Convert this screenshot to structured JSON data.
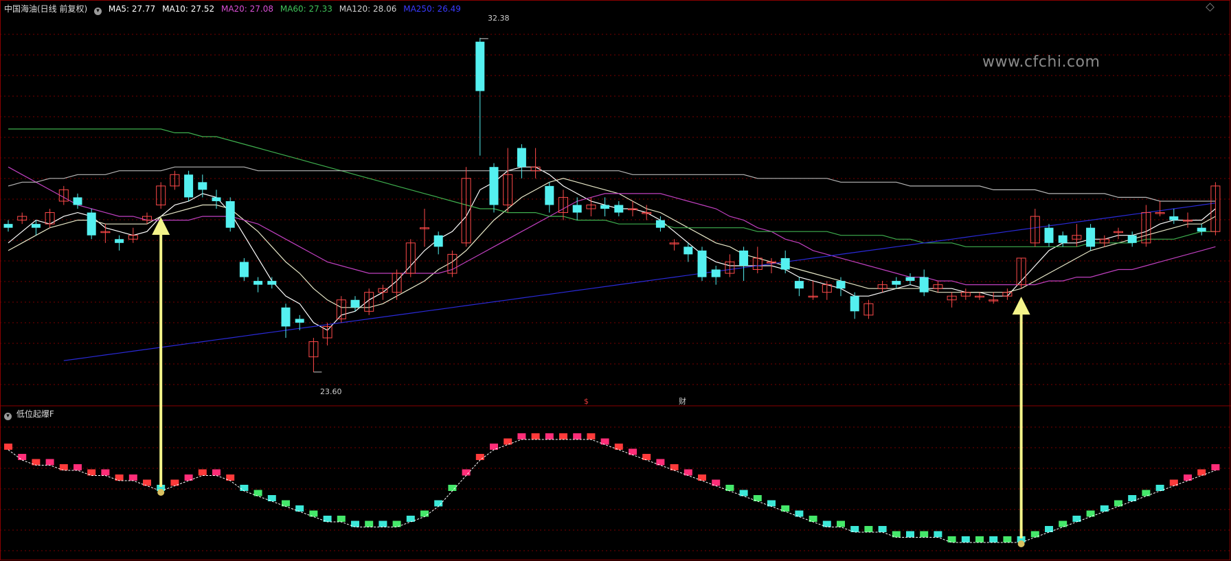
{
  "header": {
    "security": "中国海油(日线 前复权)",
    "ma_items": [
      {
        "label": "MA5: 27.77",
        "color": "#ffffff"
      },
      {
        "label": "MA10: 27.52",
        "color": "#ffffff"
      },
      {
        "label": "MA20: 27.08",
        "color": "#d94fd4"
      },
      {
        "label": "MA60: 27.33",
        "color": "#3fc35a"
      },
      {
        "label": "MA120: 28.06",
        "color": "#cfcfcf"
      },
      {
        "label": "MA250: 26.49",
        "color": "#3a3aff"
      }
    ]
  },
  "watermark": "www.cfchi.com",
  "price_high_label": "32.38",
  "price_low_label": "23.60",
  "event_marks": [
    "$",
    "财"
  ],
  "indicator_title": "低位起爆F",
  "colors": {
    "up": "#ff4a4a",
    "down": "#54f0f0",
    "grid": "#7a0000",
    "ma5": "#ffffff",
    "ma10": "#e8e8c8",
    "ma20": "#c040c0",
    "ma60": "#3fb04f",
    "ma120": "#b8b8b8",
    "ma250": "#2a2ad8",
    "arrow": "#f4f48a"
  },
  "chart_data": {
    "type": "candlestick",
    "price_range": [
      23.0,
      33.0
    ],
    "candles": [
      [
        27.5,
        27.4,
        27.6,
        27.3
      ],
      [
        27.6,
        27.7,
        27.8,
        27.5
      ],
      [
        27.5,
        27.4,
        27.6,
        27.2
      ],
      [
        27.5,
        27.8,
        27.9,
        27.4
      ],
      [
        28.1,
        28.4,
        28.5,
        28.0
      ],
      [
        28.2,
        28.0,
        28.3,
        27.9
      ],
      [
        27.8,
        27.2,
        27.9,
        27.1
      ],
      [
        27.3,
        27.3,
        27.5,
        27.0
      ],
      [
        27.1,
        27.0,
        27.2,
        26.8
      ],
      [
        27.1,
        27.2,
        27.4,
        27.0
      ],
      [
        27.6,
        27.7,
        27.8,
        27.5
      ],
      [
        28.0,
        28.5,
        28.6,
        27.9
      ],
      [
        28.5,
        28.8,
        28.9,
        28.4
      ],
      [
        28.8,
        28.2,
        28.9,
        28.1
      ],
      [
        28.6,
        28.4,
        28.8,
        28.2
      ],
      [
        28.2,
        28.1,
        28.4,
        27.9
      ],
      [
        28.1,
        27.4,
        28.2,
        27.3
      ],
      [
        26.5,
        26.1,
        26.6,
        26.0
      ],
      [
        26.0,
        25.9,
        26.1,
        25.7
      ],
      [
        26.0,
        25.9,
        26.1,
        25.8
      ],
      [
        25.3,
        24.8,
        25.4,
        24.5
      ],
      [
        25.0,
        24.9,
        25.1,
        24.7
      ],
      [
        24.0,
        24.4,
        24.5,
        23.6
      ],
      [
        24.5,
        24.8,
        24.9,
        24.3
      ],
      [
        25.0,
        25.5,
        25.6,
        24.9
      ],
      [
        25.5,
        25.3,
        25.6,
        25.2
      ],
      [
        25.2,
        25.7,
        25.8,
        25.1
      ],
      [
        25.7,
        25.8,
        25.9,
        25.5
      ],
      [
        25.7,
        26.2,
        26.3,
        25.5
      ],
      [
        26.2,
        27.0,
        27.1,
        26.1
      ],
      [
        27.4,
        27.4,
        27.9,
        26.9
      ],
      [
        27.2,
        26.9,
        27.3,
        26.7
      ],
      [
        26.2,
        26.7,
        26.8,
        26.1
      ],
      [
        27.0,
        28.7,
        29.0,
        26.9
      ],
      [
        32.3,
        31.0,
        32.4,
        29.3
      ],
      [
        29.0,
        28.0,
        29.1,
        27.8
      ],
      [
        28.0,
        28.8,
        29.5,
        27.8
      ],
      [
        29.5,
        29.0,
        29.6,
        28.7
      ],
      [
        28.9,
        29.0,
        29.5,
        28.7
      ],
      [
        28.5,
        28.0,
        28.6,
        27.8
      ],
      [
        27.8,
        28.2,
        28.4,
        27.6
      ],
      [
        28.0,
        27.8,
        28.2,
        27.6
      ],
      [
        27.9,
        28.0,
        28.2,
        27.7
      ],
      [
        28.0,
        27.9,
        28.2,
        27.7
      ],
      [
        28.0,
        27.8,
        28.1,
        27.7
      ],
      [
        27.9,
        27.9,
        28.1,
        27.7
      ],
      [
        27.8,
        27.8,
        28.0,
        27.6
      ],
      [
        27.6,
        27.4,
        27.7,
        27.3
      ],
      [
        27.0,
        27.0,
        27.1,
        26.8
      ],
      [
        26.9,
        26.7,
        27.0,
        26.5
      ],
      [
        26.8,
        26.1,
        26.9,
        26.0
      ],
      [
        26.3,
        26.1,
        26.4,
        25.9
      ],
      [
        26.2,
        26.5,
        26.7,
        26.1
      ],
      [
        26.8,
        26.4,
        26.9,
        26.0
      ],
      [
        26.3,
        26.6,
        26.9,
        26.2
      ],
      [
        26.5,
        26.5,
        26.6,
        26.2
      ],
      [
        26.6,
        26.3,
        26.8,
        26.2
      ],
      [
        26.0,
        25.8,
        26.1,
        25.6
      ],
      [
        25.6,
        25.6,
        26.0,
        25.5
      ],
      [
        25.7,
        25.9,
        26.0,
        25.5
      ],
      [
        26.0,
        25.8,
        26.1,
        25.6
      ],
      [
        25.6,
        25.2,
        25.7,
        25.0
      ],
      [
        25.1,
        25.4,
        25.5,
        25.0
      ],
      [
        25.8,
        25.9,
        26.0,
        25.7
      ],
      [
        26.0,
        25.9,
        26.1,
        25.8
      ],
      [
        26.1,
        26.0,
        26.2,
        25.9
      ],
      [
        26.1,
        25.7,
        26.3,
        25.6
      ],
      [
        25.8,
        25.9,
        26.0,
        25.7
      ],
      [
        25.5,
        25.6,
        25.7,
        25.3
      ],
      [
        25.6,
        25.7,
        25.8,
        25.5
      ],
      [
        25.6,
        25.6,
        25.7,
        25.5
      ],
      [
        25.5,
        25.5,
        25.7,
        25.4
      ],
      [
        25.6,
        25.7,
        25.8,
        25.5
      ],
      [
        25.9,
        26.6,
        26.6,
        25.8
      ],
      [
        27.0,
        27.7,
        27.9,
        26.9
      ],
      [
        27.4,
        27.0,
        27.5,
        26.9
      ],
      [
        27.2,
        27.0,
        27.3,
        26.9
      ],
      [
        27.1,
        27.2,
        27.5,
        26.9
      ],
      [
        27.4,
        26.9,
        27.5,
        26.8
      ],
      [
        27.0,
        27.1,
        27.2,
        26.9
      ],
      [
        27.3,
        27.3,
        27.4,
        27.1
      ],
      [
        27.2,
        27.0,
        27.3,
        26.9
      ],
      [
        27.0,
        27.8,
        28.0,
        26.9
      ],
      [
        27.8,
        27.8,
        28.1,
        27.7
      ],
      [
        27.7,
        27.6,
        27.9,
        27.5
      ],
      [
        27.6,
        27.6,
        27.8,
        27.4
      ],
      [
        27.4,
        27.3,
        27.5,
        27.2
      ],
      [
        27.3,
        28.5,
        28.6,
        27.2
      ]
    ],
    "ma_lines": [
      {
        "name": "MA5",
        "values": [
          27.0,
          27.3,
          27.6,
          27.5,
          27.7,
          27.8,
          27.7,
          27.4,
          27.3,
          27.2,
          27.3,
          27.7,
          28.0,
          28.1,
          28.3,
          28.2,
          27.8,
          27.2,
          26.6,
          26.0,
          25.6,
          25.4,
          24.9,
          24.7,
          25.1,
          25.2,
          25.5,
          25.7,
          26.0,
          26.4,
          26.8,
          27.1,
          27.3,
          27.7,
          28.4,
          28.6,
          28.9,
          29.0,
          29.0,
          28.8,
          28.5,
          28.3,
          28.1,
          28.0,
          27.9,
          27.9,
          27.8,
          27.6,
          27.3,
          27.0,
          26.7,
          26.5,
          26.4,
          26.4,
          26.4,
          26.4,
          26.3,
          26.1,
          26.0,
          25.9,
          25.8,
          25.6,
          25.6,
          25.7,
          25.8,
          25.9,
          25.8,
          25.8,
          25.8,
          25.7,
          25.7,
          25.6,
          25.6,
          26.0,
          26.4,
          26.8,
          27.0,
          27.0,
          27.1,
          27.1,
          27.2,
          27.2,
          27.3,
          27.5,
          27.6,
          27.6,
          27.6,
          27.9
        ]
      },
      {
        "name": "MA10",
        "values": [
          26.8,
          27.0,
          27.2,
          27.4,
          27.5,
          27.6,
          27.6,
          27.5,
          27.5,
          27.5,
          27.5,
          27.7,
          27.8,
          27.9,
          28.0,
          28.0,
          27.9,
          27.6,
          27.3,
          26.9,
          26.5,
          26.2,
          25.8,
          25.5,
          25.3,
          25.3,
          25.3,
          25.4,
          25.6,
          25.8,
          26.0,
          26.3,
          26.5,
          26.8,
          27.2,
          27.6,
          27.9,
          28.2,
          28.4,
          28.6,
          28.7,
          28.6,
          28.5,
          28.4,
          28.3,
          28.1,
          27.9,
          27.8,
          27.6,
          27.4,
          27.2,
          27.0,
          26.9,
          26.7,
          26.6,
          26.5,
          26.4,
          26.3,
          26.2,
          26.1,
          26.0,
          25.9,
          25.8,
          25.8,
          25.8,
          25.8,
          25.8,
          25.7,
          25.7,
          25.7,
          25.7,
          25.7,
          25.7,
          25.8,
          26.0,
          26.2,
          26.4,
          26.6,
          26.8,
          26.9,
          27.0,
          27.1,
          27.2,
          27.3,
          27.4,
          27.5,
          27.5,
          27.7
        ]
      },
      {
        "name": "MA20",
        "values": [
          29.0,
          28.8,
          28.6,
          28.4,
          28.2,
          28.0,
          27.9,
          27.8,
          27.7,
          27.7,
          27.6,
          27.6,
          27.6,
          27.6,
          27.7,
          27.7,
          27.7,
          27.6,
          27.5,
          27.3,
          27.1,
          26.9,
          26.7,
          26.5,
          26.4,
          26.3,
          26.2,
          26.2,
          26.2,
          26.2,
          26.2,
          26.2,
          26.3,
          26.5,
          26.7,
          26.9,
          27.1,
          27.3,
          27.5,
          27.7,
          27.9,
          28.1,
          28.2,
          28.3,
          28.3,
          28.3,
          28.3,
          28.3,
          28.2,
          28.1,
          28.0,
          27.9,
          27.7,
          27.6,
          27.4,
          27.3,
          27.1,
          27.0,
          26.8,
          26.7,
          26.6,
          26.5,
          26.4,
          26.3,
          26.2,
          26.1,
          26.1,
          26.0,
          26.0,
          25.9,
          25.9,
          25.9,
          25.9,
          25.9,
          25.9,
          26.0,
          26.0,
          26.1,
          26.1,
          26.2,
          26.3,
          26.3,
          26.4,
          26.5,
          26.6,
          26.7,
          26.8,
          26.9
        ]
      },
      {
        "name": "MA60",
        "values": [
          30.0,
          30.0,
          30.0,
          30.0,
          30.0,
          30.0,
          30.0,
          30.0,
          30.0,
          30.0,
          30.0,
          30.0,
          29.9,
          29.9,
          29.8,
          29.8,
          29.7,
          29.6,
          29.5,
          29.4,
          29.3,
          29.2,
          29.1,
          29.0,
          28.9,
          28.8,
          28.7,
          28.6,
          28.5,
          28.4,
          28.3,
          28.2,
          28.1,
          28.0,
          27.9,
          27.9,
          27.8,
          27.8,
          27.8,
          27.7,
          27.7,
          27.6,
          27.6,
          27.6,
          27.5,
          27.5,
          27.5,
          27.5,
          27.4,
          27.4,
          27.4,
          27.4,
          27.4,
          27.4,
          27.3,
          27.3,
          27.3,
          27.3,
          27.3,
          27.3,
          27.2,
          27.2,
          27.2,
          27.2,
          27.1,
          27.1,
          27.0,
          27.0,
          27.0,
          26.9,
          26.9,
          26.9,
          26.9,
          26.9,
          26.9,
          26.9,
          26.9,
          26.9,
          27.0,
          27.0,
          27.0,
          27.0,
          27.1,
          27.1,
          27.1,
          27.2,
          27.3,
          27.3
        ]
      },
      {
        "name": "MA120",
        "values": [
          28.5,
          28.6,
          28.6,
          28.7,
          28.7,
          28.8,
          28.8,
          28.8,
          28.9,
          28.9,
          28.9,
          28.9,
          29.0,
          29.0,
          29.0,
          29.0,
          29.0,
          29.0,
          28.9,
          28.9,
          28.9,
          28.9,
          28.9,
          28.9,
          28.9,
          28.9,
          28.9,
          28.9,
          28.9,
          28.9,
          28.9,
          28.9,
          28.9,
          28.9,
          28.9,
          28.9,
          28.9,
          28.9,
          28.9,
          28.9,
          28.9,
          28.9,
          28.9,
          28.9,
          28.9,
          28.8,
          28.8,
          28.8,
          28.8,
          28.8,
          28.8,
          28.8,
          28.8,
          28.8,
          28.7,
          28.7,
          28.7,
          28.7,
          28.7,
          28.7,
          28.6,
          28.6,
          28.6,
          28.6,
          28.6,
          28.5,
          28.5,
          28.5,
          28.5,
          28.5,
          28.5,
          28.4,
          28.4,
          28.4,
          28.4,
          28.3,
          28.3,
          28.3,
          28.3,
          28.3,
          28.2,
          28.2,
          28.2,
          28.1,
          28.1,
          28.1,
          28.1,
          28.1
        ]
      },
      {
        "name": "MA250",
        "values": [
          null,
          null,
          null,
          null,
          23.9,
          23.95,
          24.0,
          24.05,
          24.1,
          24.15,
          24.2,
          24.25,
          24.3,
          24.35,
          24.4,
          24.45,
          24.5,
          24.55,
          24.6,
          24.65,
          24.7,
          24.75,
          24.8,
          24.85,
          24.9,
          24.95,
          25.0,
          25.05,
          25.1,
          25.15,
          25.2,
          25.25,
          25.3,
          25.35,
          25.4,
          25.45,
          25.5,
          25.55,
          25.6,
          25.65,
          25.7,
          25.75,
          25.8,
          25.85,
          25.9,
          25.95,
          26.0,
          26.05,
          26.1,
          26.15,
          26.2,
          26.25,
          26.3,
          26.35,
          26.4,
          26.45,
          26.5,
          26.55,
          26.6,
          26.65,
          26.7,
          26.75,
          26.8,
          26.85,
          26.9,
          26.95,
          27.0,
          27.05,
          27.1,
          27.15,
          27.2,
          27.25,
          27.3,
          27.35,
          27.4,
          27.45,
          27.5,
          27.55,
          27.6,
          27.65,
          27.7,
          27.75,
          27.8,
          27.85,
          27.9,
          27.95,
          28.0,
          28.05
        ]
      }
    ],
    "indicator": {
      "values": [
        8,
        6,
        5,
        5,
        4,
        4,
        3,
        3,
        2,
        2,
        1,
        0,
        1,
        2,
        3,
        3,
        2,
        0,
        -1,
        -2,
        -3,
        -4,
        -5,
        -6,
        -6,
        -7,
        -7,
        -7,
        -7,
        -6,
        -5,
        -3,
        0,
        3,
        6,
        8,
        9,
        10,
        10,
        10,
        10,
        10,
        10,
        9,
        8,
        7,
        6,
        5,
        4,
        3,
        2,
        1,
        0,
        -1,
        -2,
        -3,
        -4,
        -5,
        -6,
        -7,
        -7,
        -8,
        -8,
        -8,
        -9,
        -9,
        -9,
        -9,
        -10,
        -10,
        -10,
        -10,
        -10,
        -10,
        -9,
        -8,
        -7,
        -6,
        -5,
        -4,
        -3,
        -2,
        -1,
        0,
        1,
        2,
        3,
        4
      ],
      "range": [
        -12,
        14
      ],
      "signals": [
        11,
        73
      ]
    }
  }
}
